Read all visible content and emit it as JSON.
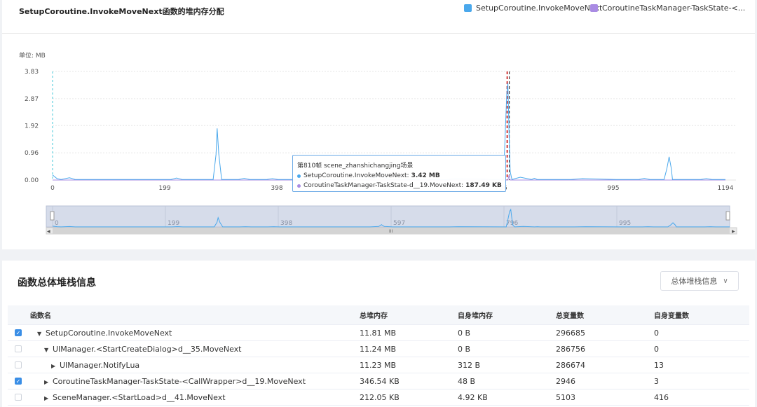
{
  "chart": {
    "title": "SetupCoroutine.InvokeMoveNext函数的堆内存分配",
    "legend": [
      {
        "name": "SetupCoroutine.InvokeMoveNext",
        "color": "#4aa8ec"
      },
      {
        "name": "CoroutineTaskManager-TaskState-<...",
        "color": "#a98be3"
      }
    ],
    "unit_label": "单位: MB",
    "tooltip": {
      "header": "第810帧 scene_zhanshichangjing场景",
      "rows": [
        {
          "label": "SetupCoroutine.InvokeMoveNext:",
          "value": "3.42 MB",
          "color": "#4aa8ec"
        },
        {
          "label": "CoroutineTaskManager-TaskState-d__19.MoveNext:",
          "value": "187.49 KB",
          "color": "#a98be3"
        }
      ]
    },
    "scroll_thumb_glyph": "III"
  },
  "chart_data": {
    "type": "line",
    "xlabel": "",
    "ylabel": "",
    "ylim": [
      0,
      3.83
    ],
    "xlim": [
      0,
      1194
    ],
    "y_ticks": [
      "3.83",
      "2.87",
      "1.92",
      "0.96",
      "0.00"
    ],
    "x_ticks": [
      "0",
      "199",
      "398",
      "597",
      "796",
      "995",
      "1194"
    ],
    "slider_ticks": [
      "0",
      "199",
      "398",
      "597",
      "796",
      "995"
    ],
    "series": [
      {
        "name": "SetupCoroutine.InvokeMoveNext",
        "color": "#4aa8ec",
        "x": [
          0,
          8,
          15,
          30,
          40,
          210,
          220,
          230,
          285,
          290,
          292,
          295,
          300,
          330,
          340,
          350,
          380,
          390,
          400,
          560,
          575,
          580,
          585,
          600,
          640,
          700,
          715,
          800,
          803,
          806,
          808,
          810,
          812,
          815,
          830,
          850,
          855,
          860,
          920,
          940,
          1000,
          1040,
          1050,
          1060,
          1085,
          1090,
          1094,
          1098,
          1100,
          1110,
          1150,
          1160,
          1170,
          1194
        ],
        "y": [
          0.18,
          0.05,
          0.02,
          0.08,
          0.02,
          0.02,
          0.07,
          0.02,
          0.02,
          0.9,
          1.82,
          0.9,
          0.02,
          0.02,
          0.06,
          0.02,
          0.02,
          0.05,
          0.02,
          0.02,
          0.1,
          0.45,
          0.1,
          0.02,
          0.02,
          0.02,
          0.05,
          0.02,
          1.5,
          3.05,
          3.42,
          1.6,
          0.3,
          0.02,
          0.1,
          0.02,
          0.06,
          0.02,
          0.02,
          0.05,
          0.02,
          0.02,
          0.06,
          0.02,
          0.02,
          0.4,
          0.82,
          0.4,
          0.02,
          0.02,
          0.02,
          0.05,
          0.02,
          0.02
        ]
      },
      {
        "name": "CoroutineTaskManager-TaskState-d__19.MoveNext",
        "color": "#a98be3",
        "x": [
          0,
          808,
          810,
          812,
          1194
        ],
        "y": [
          0,
          0,
          0.18,
          0,
          0
        ]
      }
    ],
    "markers": {
      "cursor_x": 0,
      "highlight_x": 808
    }
  },
  "section": {
    "title": "函数总体堆栈信息",
    "dropdown_label": "总体堆栈信息"
  },
  "table": {
    "headers": [
      "函数名",
      "总堆内存",
      "自身堆内存",
      "总变量数",
      "自身变量数"
    ],
    "rows": [
      {
        "checked": true,
        "depth": 0,
        "caret": "▼",
        "name": "SetupCoroutine.InvokeMoveNext",
        "total_heap": "11.81 MB",
        "self_heap": "0 B",
        "total_vars": "296685",
        "self_vars": "0"
      },
      {
        "checked": false,
        "depth": 1,
        "caret": "▼",
        "name": "UIManager.<StartCreateDialog>d__35.MoveNext",
        "total_heap": "11.24 MB",
        "self_heap": "0 B",
        "total_vars": "286756",
        "self_vars": "0"
      },
      {
        "checked": false,
        "depth": 2,
        "caret": "▶",
        "name": "UIManager.NotifyLua",
        "total_heap": "11.23 MB",
        "self_heap": "312 B",
        "total_vars": "286674",
        "self_vars": "13"
      },
      {
        "checked": true,
        "depth": 1,
        "caret": "▶",
        "name": "CoroutineTaskManager-TaskState-<CallWrapper>d__19.MoveNext",
        "total_heap": "346.54 KB",
        "self_heap": "48 B",
        "total_vars": "2946",
        "self_vars": "3"
      },
      {
        "checked": false,
        "depth": 1,
        "caret": "▶",
        "name": "SceneManager.<StartLoad>d__41.MoveNext",
        "total_heap": "212.05 KB",
        "self_heap": "4.92 KB",
        "total_vars": "5103",
        "self_vars": "416"
      }
    ]
  }
}
